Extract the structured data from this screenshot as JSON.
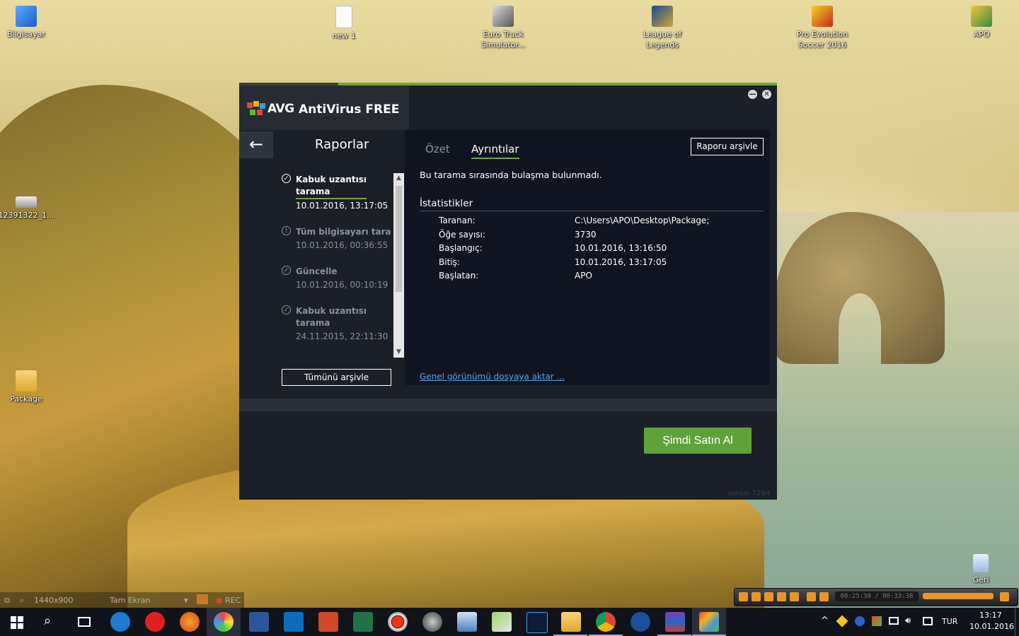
{
  "desktop": {
    "icons": [
      {
        "label": "Bilgisayar"
      },
      {
        "label": "new 1"
      },
      {
        "label": "Euro Truck Simulator..."
      },
      {
        "label": "League of Legends"
      },
      {
        "label": "Pro Evolution Soccer 2016"
      },
      {
        "label": "APO"
      },
      {
        "label": "12391322_1..."
      },
      {
        "label": "Package"
      },
      {
        "label": "Geri"
      }
    ]
  },
  "avg": {
    "logo": "AVG",
    "title": "AntiVirus FREE",
    "minimize_label": "—",
    "close_label": "✕",
    "back_label": "←",
    "reports_title": "Raporlar",
    "reports": [
      {
        "name": "Kabuk uzantısı tarama",
        "date": "10.01.2016, 13:17:05",
        "icon": "check-icon"
      },
      {
        "name": "Tüm bilgisayarı tara",
        "date": "10.01.2016, 00:36:55",
        "icon": "warning-icon"
      },
      {
        "name": "Güncelle",
        "date": "10.01.2016, 00:10:19",
        "icon": "check-icon"
      },
      {
        "name": "Kabuk uzantısı tarama",
        "date": "24.11.2015, 22:11:30",
        "icon": "check-icon"
      }
    ],
    "archive_all_label": "Tümünü arşivle",
    "tabs": [
      "Özet",
      "Ayrıntılar"
    ],
    "active_tab": "Ayrıntılar",
    "archive_report_label": "Raporu arşivle",
    "message": "Bu tarama sırasında bulaşma bulunmadı.",
    "stats_title": "İstatistikler",
    "stats": [
      {
        "label": "Taranan:",
        "value": "C:\\Users\\APO\\Desktop\\Package;"
      },
      {
        "label": "Öğe sayısı:",
        "value": "3730"
      },
      {
        "label": "Başlangıç:",
        "value": "10.01.2016, 13:16:50"
      },
      {
        "label": "Bitiş:",
        "value": "10.01.2016, 13:17:05"
      },
      {
        "label": "Başlatan:",
        "value": "APO"
      }
    ],
    "export_link": "Genel görünümü dosyaya aktar ...",
    "buy_label": "Şimdi Satın Al",
    "version": "sürüm 7294",
    "colors": {
      "accent": "#6fa53a",
      "bg": "#1b1f27",
      "panel": "#111522",
      "link": "#4fa3e6"
    }
  },
  "recorder": {
    "resolution": "1440x900",
    "mode": "Tam Ekran",
    "rec_label": "REC"
  },
  "player": {
    "time": "00:25:38 / 00:33:38"
  },
  "taskbar": {
    "apps": [
      "start-icon",
      "search-icon",
      "task-view-icon",
      "edge-icon",
      "opera-icon",
      "firefox-icon",
      "pinwheel-icon",
      "word-icon",
      "outlook-icon",
      "powerpoint-icon",
      "excel-icon",
      "record-icon",
      "camera-icon",
      "scanner-icon",
      "notepad-icon",
      "photoshop-icon",
      "explorer-icon",
      "chrome-icon",
      "crescent-icon",
      "winrar-icon",
      "avg-icon"
    ],
    "language": "TUR",
    "time": "13:17",
    "date": "10.01.2016"
  }
}
